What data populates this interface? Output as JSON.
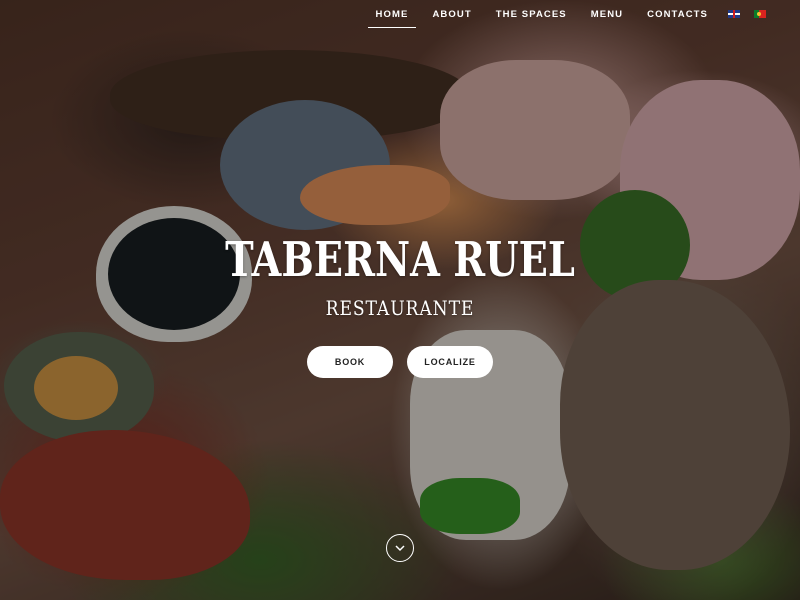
{
  "nav": {
    "items": [
      {
        "label": "HOME",
        "active": true
      },
      {
        "label": "ABOUT",
        "active": false
      },
      {
        "label": "THE SPACES",
        "active": false
      },
      {
        "label": "MENU",
        "active": false
      },
      {
        "label": "CONTACTS",
        "active": false
      }
    ],
    "languages": [
      {
        "icon": "uk-flag-icon"
      },
      {
        "icon": "portugal-flag-icon"
      }
    ]
  },
  "hero": {
    "title": "TABERNA RUEL",
    "subtitle": "RESTAURANTE",
    "buttons": {
      "book": "BOOK",
      "localize": "LOCALIZE"
    },
    "scroll_icon": "chevron-down-icon"
  },
  "colors": {
    "text": "#ffffff",
    "button_bg": "#ffffff",
    "button_text": "#222222"
  }
}
